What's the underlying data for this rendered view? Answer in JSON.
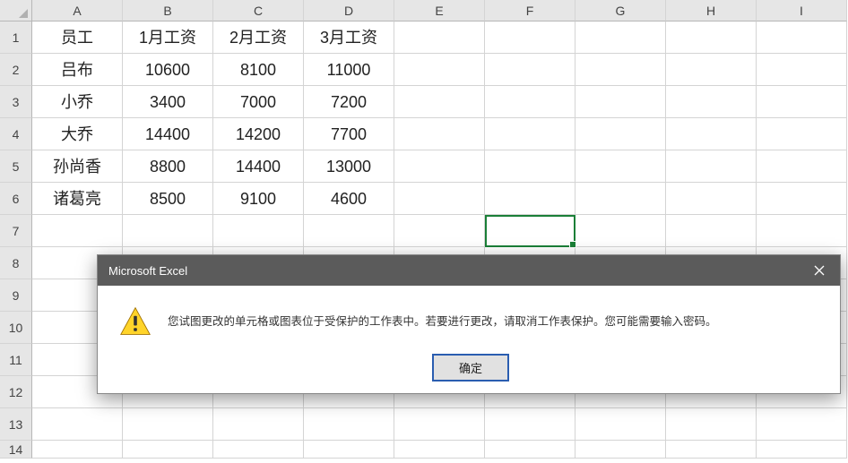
{
  "columns": [
    "A",
    "B",
    "C",
    "D",
    "E",
    "F",
    "G",
    "H",
    "I"
  ],
  "rows": [
    "1",
    "2",
    "3",
    "4",
    "5",
    "6",
    "7",
    "8",
    "9",
    "10",
    "11",
    "12",
    "13",
    "14"
  ],
  "cells": {
    "A1": "员工",
    "B1": "1月工资",
    "C1": "2月工资",
    "D1": "3月工资",
    "A2": "吕布",
    "B2": "10600",
    "C2": "8100",
    "D2": "11000",
    "A3": "小乔",
    "B3": "3400",
    "C3": "7000",
    "D3": "7200",
    "A4": "大乔",
    "B4": "14400",
    "C4": "14200",
    "D4": "7700",
    "A5": "孙尚香",
    "B5": "8800",
    "C5": "14400",
    "D5": "13000",
    "A6": "诸葛亮",
    "B6": "8500",
    "C6": "9100",
    "D6": "4600"
  },
  "selected_cell": "F7",
  "dialog": {
    "title": "Microsoft Excel",
    "message": "您试图更改的单元格或图表位于受保护的工作表中。若要进行更改，请取消工作表保护。您可能需要输入密码。",
    "ok_label": "确定",
    "close_aria": "Close"
  }
}
